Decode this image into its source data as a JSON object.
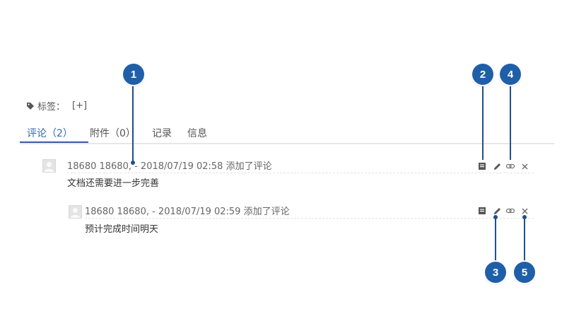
{
  "tags": {
    "label": "标签：",
    "add": "[+]",
    "icon": "tag-icon"
  },
  "tabs": [
    {
      "label": "评论",
      "count": "（2）",
      "active": true
    },
    {
      "label": "附件",
      "count": "（0）",
      "active": false
    },
    {
      "label": "记录",
      "count": "",
      "active": false
    },
    {
      "label": "信息",
      "count": "",
      "active": false
    }
  ],
  "comments": [
    {
      "header": "18680 18680, - 2018/07/19 02:58 添加了评论",
      "body": "文档还需要进一步完善"
    },
    {
      "header": "18680 18680, - 2018/07/19 02:59 添加了评论",
      "body": "预计完成时间明天"
    }
  ],
  "actions": [
    "note-icon",
    "pencil-icon",
    "link-icon",
    "close-icon"
  ],
  "callouts": [
    "1",
    "2",
    "3",
    "4",
    "5"
  ],
  "colors": {
    "accent": "#3b5aa8",
    "callout": "#1f5fa8"
  }
}
